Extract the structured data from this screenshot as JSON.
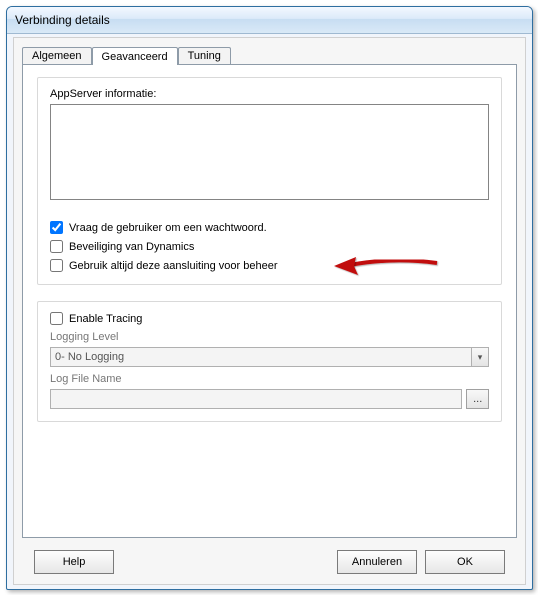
{
  "window": {
    "title": "Verbinding details"
  },
  "tabs": {
    "general": "Algemeen",
    "advanced": "Geavanceerd",
    "tuning": "Tuning"
  },
  "group1": {
    "appserver_label": "AppServer informatie:",
    "appserver_value": "",
    "prompt_password_label": "Vraag de gebruiker om een wachtwoord.",
    "prompt_password_checked": true,
    "dynamics_security_label": "Beveiliging van Dynamics",
    "dynamics_security_checked": false,
    "always_use_label": "Gebruik altijd deze aansluiting voor beheer",
    "always_use_checked": false
  },
  "group2": {
    "enable_tracing_label": "Enable Tracing",
    "enable_tracing_checked": false,
    "logging_level_label": "Logging Level",
    "logging_level_value": "0- No Logging",
    "log_file_label": "Log File Name",
    "log_file_value": "",
    "browse_label": "..."
  },
  "buttons": {
    "help": "Help",
    "cancel": "Annuleren",
    "ok": "OK"
  }
}
